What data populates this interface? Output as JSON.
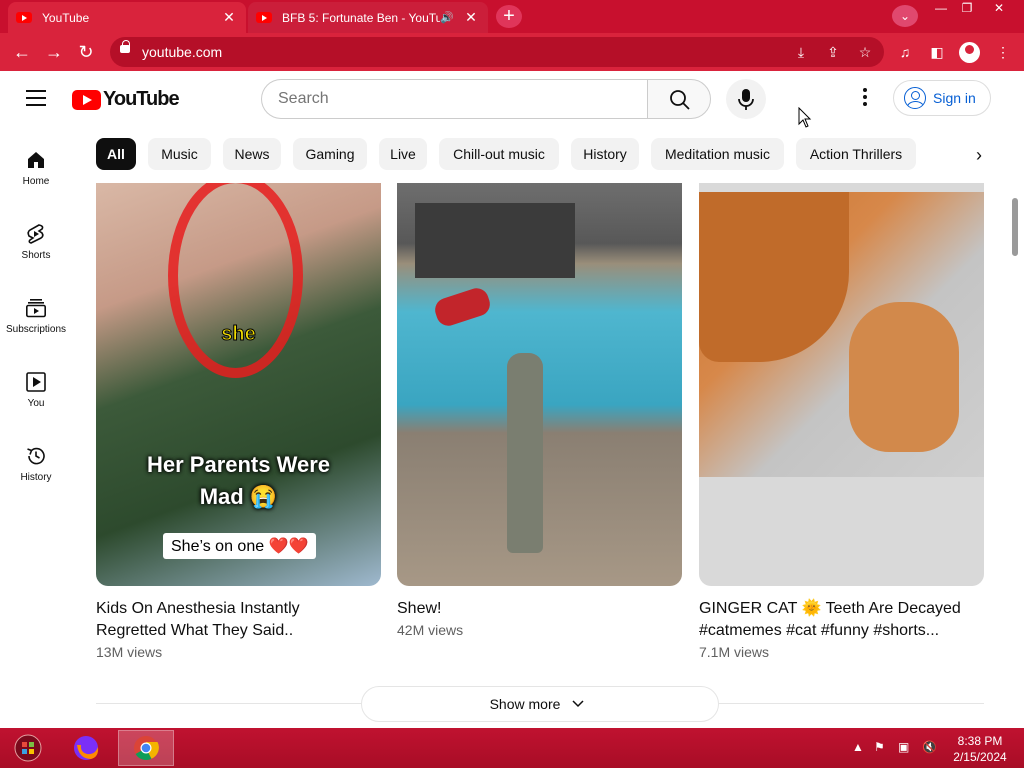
{
  "browser": {
    "tabs": [
      {
        "title": "YouTube",
        "active": true
      },
      {
        "title": "BFB 5: Fortunate Ben - YouTu",
        "active": false,
        "audio": true
      }
    ],
    "url": "youtube.com",
    "accent_color": "#d9233c"
  },
  "masthead": {
    "logo_text": "YouTube",
    "search_placeholder": "Search",
    "signin_label": "Sign in"
  },
  "guide": [
    {
      "label": "Home",
      "icon": "home-icon"
    },
    {
      "label": "Shorts",
      "icon": "shorts-icon"
    },
    {
      "label": "Subscriptions",
      "icon": "subscriptions-icon"
    },
    {
      "label": "You",
      "icon": "you-icon"
    },
    {
      "label": "History",
      "icon": "history-icon"
    }
  ],
  "chips": [
    {
      "label": "All",
      "selected": true
    },
    {
      "label": "Music"
    },
    {
      "label": "News"
    },
    {
      "label": "Gaming"
    },
    {
      "label": "Live"
    },
    {
      "label": "Chill-out music"
    },
    {
      "label": "History"
    },
    {
      "label": "Meditation music"
    },
    {
      "label": "Action Thrillers"
    }
  ],
  "videos": [
    {
      "title_line1": "Kids On Anesthesia Instantly",
      "title_line2": "Regretted What They Said..",
      "views": "13M views",
      "overlay_top": "she",
      "overlay_mid1": "Her Parents Were",
      "overlay_mid2": "Mad 😭",
      "overlay_bottom": "She’s on one ❤️❤️"
    },
    {
      "title_line1": "Shew!",
      "title_line2": "",
      "views": "42M views"
    },
    {
      "title_line1": "GINGER CAT 🌞 Teeth Are Decayed",
      "title_line2": "#catmemes #cat #funny #shorts...",
      "views": "7.1M views"
    }
  ],
  "show_more_label": "Show more",
  "taskbar": {
    "time": "8:38 PM",
    "date": "2/15/2024"
  }
}
